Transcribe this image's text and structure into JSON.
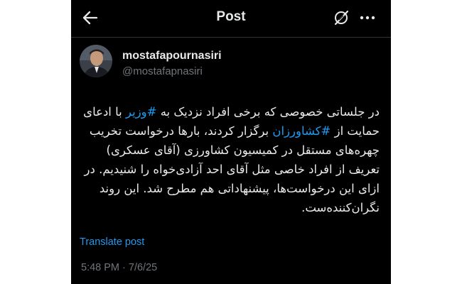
{
  "header": {
    "title": "Post",
    "back_icon": "arrow-left-icon",
    "grok_icon": "grok-icon",
    "more_icon": "more-horizontal-icon"
  },
  "author": {
    "name": "mostafapournasiri",
    "handle": "@mostafapnasiri"
  },
  "post": {
    "seg1": "در جلساتی خصوصی که برخی افراد نزدیک به ",
    "hashtag1": "#وزیر",
    "seg2": " با ادعای حمایت از ",
    "hashtag2": "#کشاورزان",
    "seg3": " برگزار کردند، بارها درخواست تخریب چهره‌های مستقل در کمیسیون کشاورزی (آقای عسکری) تعریف از افراد خاصی مثل آقای احد آزادی‌خواه را شنیدیم. در ازای این درخواست‌ها، پیشنهاداتی هم مطرح شد. این روند نگران‌کننده‌ست."
  },
  "actions": {
    "translate_label": "Translate post"
  },
  "meta": {
    "timestamp": "5:48 PM · 7/6/25"
  },
  "colors": {
    "background": "#000000",
    "link": "#1d9bf0",
    "text": "#e7e9ea",
    "muted": "#71767b"
  }
}
